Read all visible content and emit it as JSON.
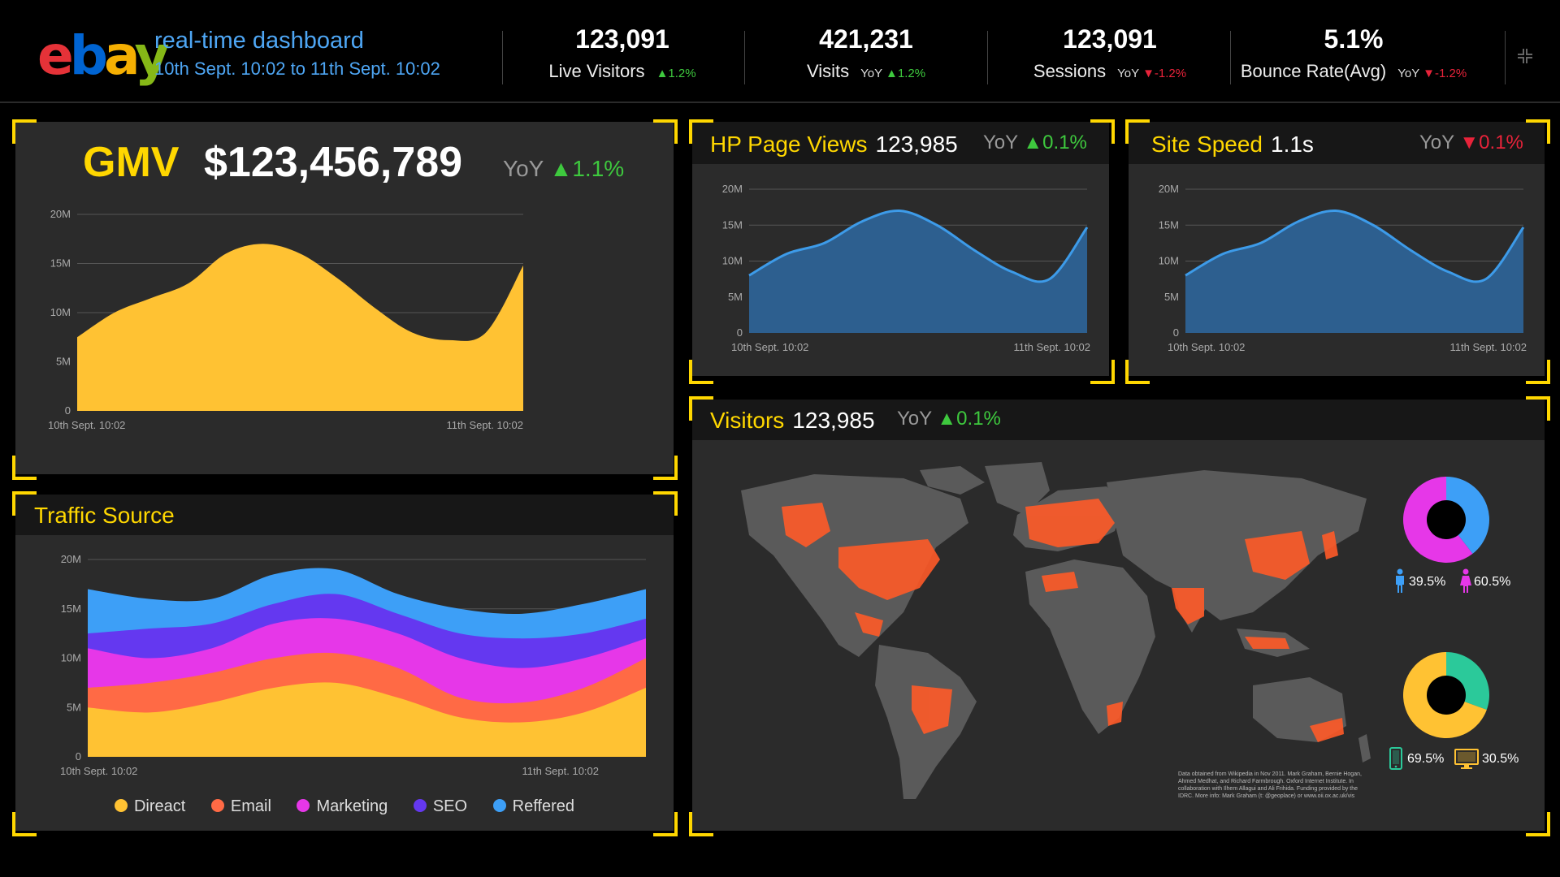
{
  "header": {
    "logo": {
      "e": "e",
      "b": "b",
      "a": "a",
      "y": "y",
      "colors": [
        "#e53238",
        "#0064d2",
        "#f5af02",
        "#86b817"
      ]
    },
    "title": "real-time dashboard",
    "range": "10th Sept. 10:02 to 11th Sept. 10:02",
    "stats": [
      {
        "value": "123,091",
        "label": "Live Visitors",
        "yoy": "",
        "dir": "up",
        "change": "1.2%"
      },
      {
        "value": "421,231",
        "label": "Visits",
        "yoy": "YoY",
        "dir": "up",
        "change": "1.2%"
      },
      {
        "value": "123,091",
        "label": "Sessions",
        "yoy": "YoY",
        "dir": "down",
        "change": "-1.2%"
      },
      {
        "value": "5.1%",
        "label": "Bounce Rate(Avg)",
        "yoy": "YoY",
        "dir": "down",
        "change": "-1.2%"
      }
    ]
  },
  "colors": {
    "accent": "#ffd700",
    "up": "#3ec93e",
    "down": "#e8233a",
    "gmv_fill": "#ffc233",
    "line": "#3d9be9",
    "line_fill": "#2d5f8f",
    "map_dots": "#ff5a28"
  },
  "gmv": {
    "title": "GMV",
    "value": "$123,456,789",
    "yoy": "YoY",
    "change": "1.1%"
  },
  "hp": {
    "title": "HP Page Views",
    "value": "123,985",
    "yoy": "YoY",
    "change": "0.1%"
  },
  "speed": {
    "title": "Site Speed",
    "value": "1.1s",
    "yoy": "YoY",
    "change": "0.1%"
  },
  "traffic": {
    "title": "Traffic Source"
  },
  "visitors": {
    "title": "Visitors",
    "value": "123,985",
    "yoy": "YoY",
    "change": "0.1%",
    "gender": {
      "male": "39.5%",
      "female": "60.5%"
    },
    "device": {
      "mobile": "69.5%",
      "desktop": "30.5%"
    },
    "credit": "Data obtained from Wikipedia in Nov 2011. Mark Graham, Bernie Hogan, Ahmed Medhat, and Richard Farmbrough. Oxford Internet Institute. In collaboration with Ilhem Allagui and Ali Frihida. Funding provided by the IDRC. More info: Mark Graham (t: @geoplace) or www.oii.ox.ac.uk/vis"
  },
  "chart_data": [
    {
      "type": "area",
      "id": "gmv",
      "title": "GMV",
      "x": [
        "10th Sept. 10:02",
        "",
        "",
        "",
        "",
        "",
        "",
        "",
        "",
        "",
        "",
        "",
        "11th Sept. 10:02"
      ],
      "xticks": [
        "10th Sept. 10:02",
        "11th Sept. 10:02"
      ],
      "yticks": [
        "0",
        "5M",
        "10M",
        "15M",
        "20M"
      ],
      "ylim": [
        0,
        20
      ],
      "series": [
        {
          "values": [
            7.5,
            10,
            11.5,
            13,
            16,
            17,
            16,
            13.5,
            10.5,
            8,
            7.2,
            8,
            14.8
          ]
        }
      ]
    },
    {
      "type": "area",
      "id": "hp",
      "title": "HP Page Views",
      "x": [
        "10th Sept. 10:02",
        "",
        "",
        "",
        "",
        "",
        "",
        "",
        "",
        "11th Sept. 10:02"
      ],
      "xticks": [
        "10th Sept. 10:02",
        "11th Sept. 10:02"
      ],
      "yticks": [
        "0",
        "5M",
        "10M",
        "15M",
        "20M"
      ],
      "ylim": [
        0,
        20
      ],
      "series": [
        {
          "values": [
            8,
            11,
            12.5,
            15.5,
            17,
            15,
            11.5,
            8.5,
            7.5,
            14.7
          ]
        }
      ]
    },
    {
      "type": "area",
      "id": "speed",
      "title": "Site Speed",
      "x": [
        "10th Sept. 10:02",
        "",
        "",
        "",
        "",
        "",
        "",
        "",
        "",
        "11th Sept. 10:02"
      ],
      "xticks": [
        "10th Sept. 10:02",
        "11th Sept. 10:02"
      ],
      "yticks": [
        "0",
        "5M",
        "10M",
        "15M",
        "20M"
      ],
      "ylim": [
        0,
        20
      ],
      "series": [
        {
          "values": [
            8,
            11,
            12.5,
            15.5,
            17,
            15,
            11.5,
            8.5,
            7.5,
            14.7
          ]
        }
      ]
    },
    {
      "type": "area",
      "id": "traffic",
      "title": "Traffic Source",
      "stacked": true,
      "x": [
        "10th Sept. 10:02",
        "",
        "",
        "",
        "",
        "",
        "",
        "",
        "",
        "11th Sept. 10:02"
      ],
      "xticks": [
        "10th Sept. 10:02",
        "11th Sept. 10:02"
      ],
      "yticks": [
        "0",
        "5M",
        "10M",
        "15M",
        "20M"
      ],
      "ylim": [
        0,
        20
      ],
      "series": [
        {
          "name": "Direact",
          "color": "#ffc233",
          "values": [
            5,
            4.5,
            5.5,
            7,
            7.5,
            6,
            4,
            3.5,
            4.5,
            7
          ]
        },
        {
          "name": "Email",
          "color": "#ff6a45",
          "values": [
            2,
            3,
            3,
            3,
            3,
            3,
            2,
            2,
            2.5,
            3
          ]
        },
        {
          "name": "Marketing",
          "color": "#e637e8",
          "values": [
            4,
            2.5,
            2.5,
            3.5,
            3.5,
            3.5,
            4,
            3.5,
            3,
            2
          ]
        },
        {
          "name": "SEO",
          "color": "#6438f0",
          "values": [
            1.5,
            3,
            2.5,
            2,
            2.5,
            2,
            2.5,
            3,
            2.5,
            2
          ]
        },
        {
          "name": "Reffered",
          "color": "#3d9ff7",
          "values": [
            4.5,
            3,
            2.5,
            3,
            2.5,
            2,
            2.5,
            2.5,
            3,
            3
          ]
        }
      ]
    },
    {
      "type": "pie",
      "id": "gender",
      "categories": [
        "male",
        "female"
      ],
      "values": [
        39.5,
        60.5
      ],
      "colors": [
        "#3d9ff7",
        "#e637e8"
      ]
    },
    {
      "type": "pie",
      "id": "device",
      "categories": [
        "mobile",
        "desktop"
      ],
      "values": [
        30.5,
        69.5
      ],
      "colors": [
        "#2bc99a",
        "#ffc233"
      ]
    }
  ]
}
